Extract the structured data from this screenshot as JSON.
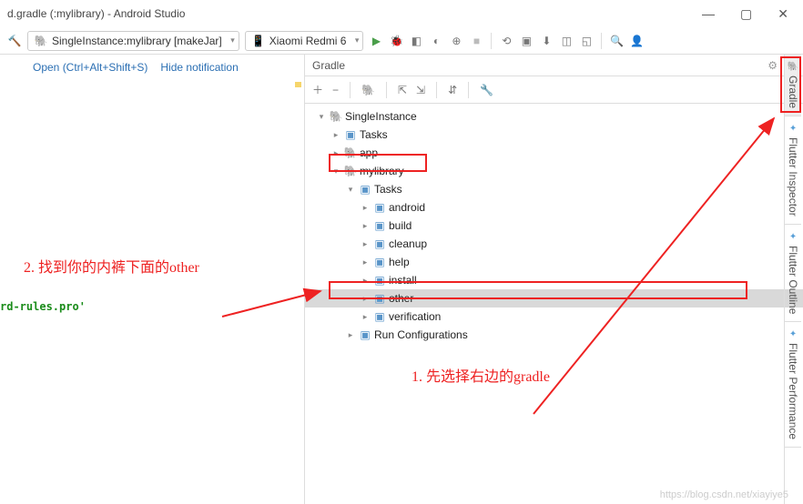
{
  "window": {
    "title": "d.gradle (:mylibrary) - Android Studio"
  },
  "toolbar": {
    "config": "SingleInstance:mylibrary [makeJar]",
    "device": "Xiaomi Redmi 6"
  },
  "header_links": {
    "open": "Open (Ctrl+Alt+Shift+S)",
    "hide": "Hide notification"
  },
  "gradle_panel": {
    "title": "Gradle",
    "tree": {
      "root": "SingleInstance",
      "items": [
        {
          "label": "Tasks",
          "depth": 1,
          "arrow": "▸",
          "icon": "folder"
        },
        {
          "label": "app",
          "depth": 1,
          "arrow": "▸",
          "icon": "elephant"
        },
        {
          "label": "mylibrary",
          "depth": 1,
          "arrow": "▾",
          "icon": "elephant",
          "boxed": true
        },
        {
          "label": "Tasks",
          "depth": 2,
          "arrow": "▾",
          "icon": "folder"
        },
        {
          "label": "android",
          "depth": 3,
          "arrow": "▸",
          "icon": "folder"
        },
        {
          "label": "build",
          "depth": 3,
          "arrow": "▸",
          "icon": "folder"
        },
        {
          "label": "cleanup",
          "depth": 3,
          "arrow": "▸",
          "icon": "folder"
        },
        {
          "label": "help",
          "depth": 3,
          "arrow": "▸",
          "icon": "folder"
        },
        {
          "label": "install",
          "depth": 3,
          "arrow": "▸",
          "icon": "folder"
        },
        {
          "label": "other",
          "depth": 3,
          "arrow": "▸",
          "icon": "folder",
          "selected": true,
          "boxed": true
        },
        {
          "label": "verification",
          "depth": 3,
          "arrow": "▸",
          "icon": "folder"
        },
        {
          "label": "Run Configurations",
          "depth": 2,
          "arrow": "▸",
          "icon": "folder"
        }
      ]
    }
  },
  "right_tabs": {
    "gradle": "Gradle",
    "inspector": "Flutter Inspector",
    "outline": "Flutter Outline",
    "perf": "Flutter Performance"
  },
  "annotations": {
    "step1": "1. 先选择右边的gradle",
    "step2": "2. 找到你的内裤下面的other"
  },
  "editor_fragment": "rd-rules.pro'",
  "watermark": "https://blog.csdn.net/xiayiye5"
}
